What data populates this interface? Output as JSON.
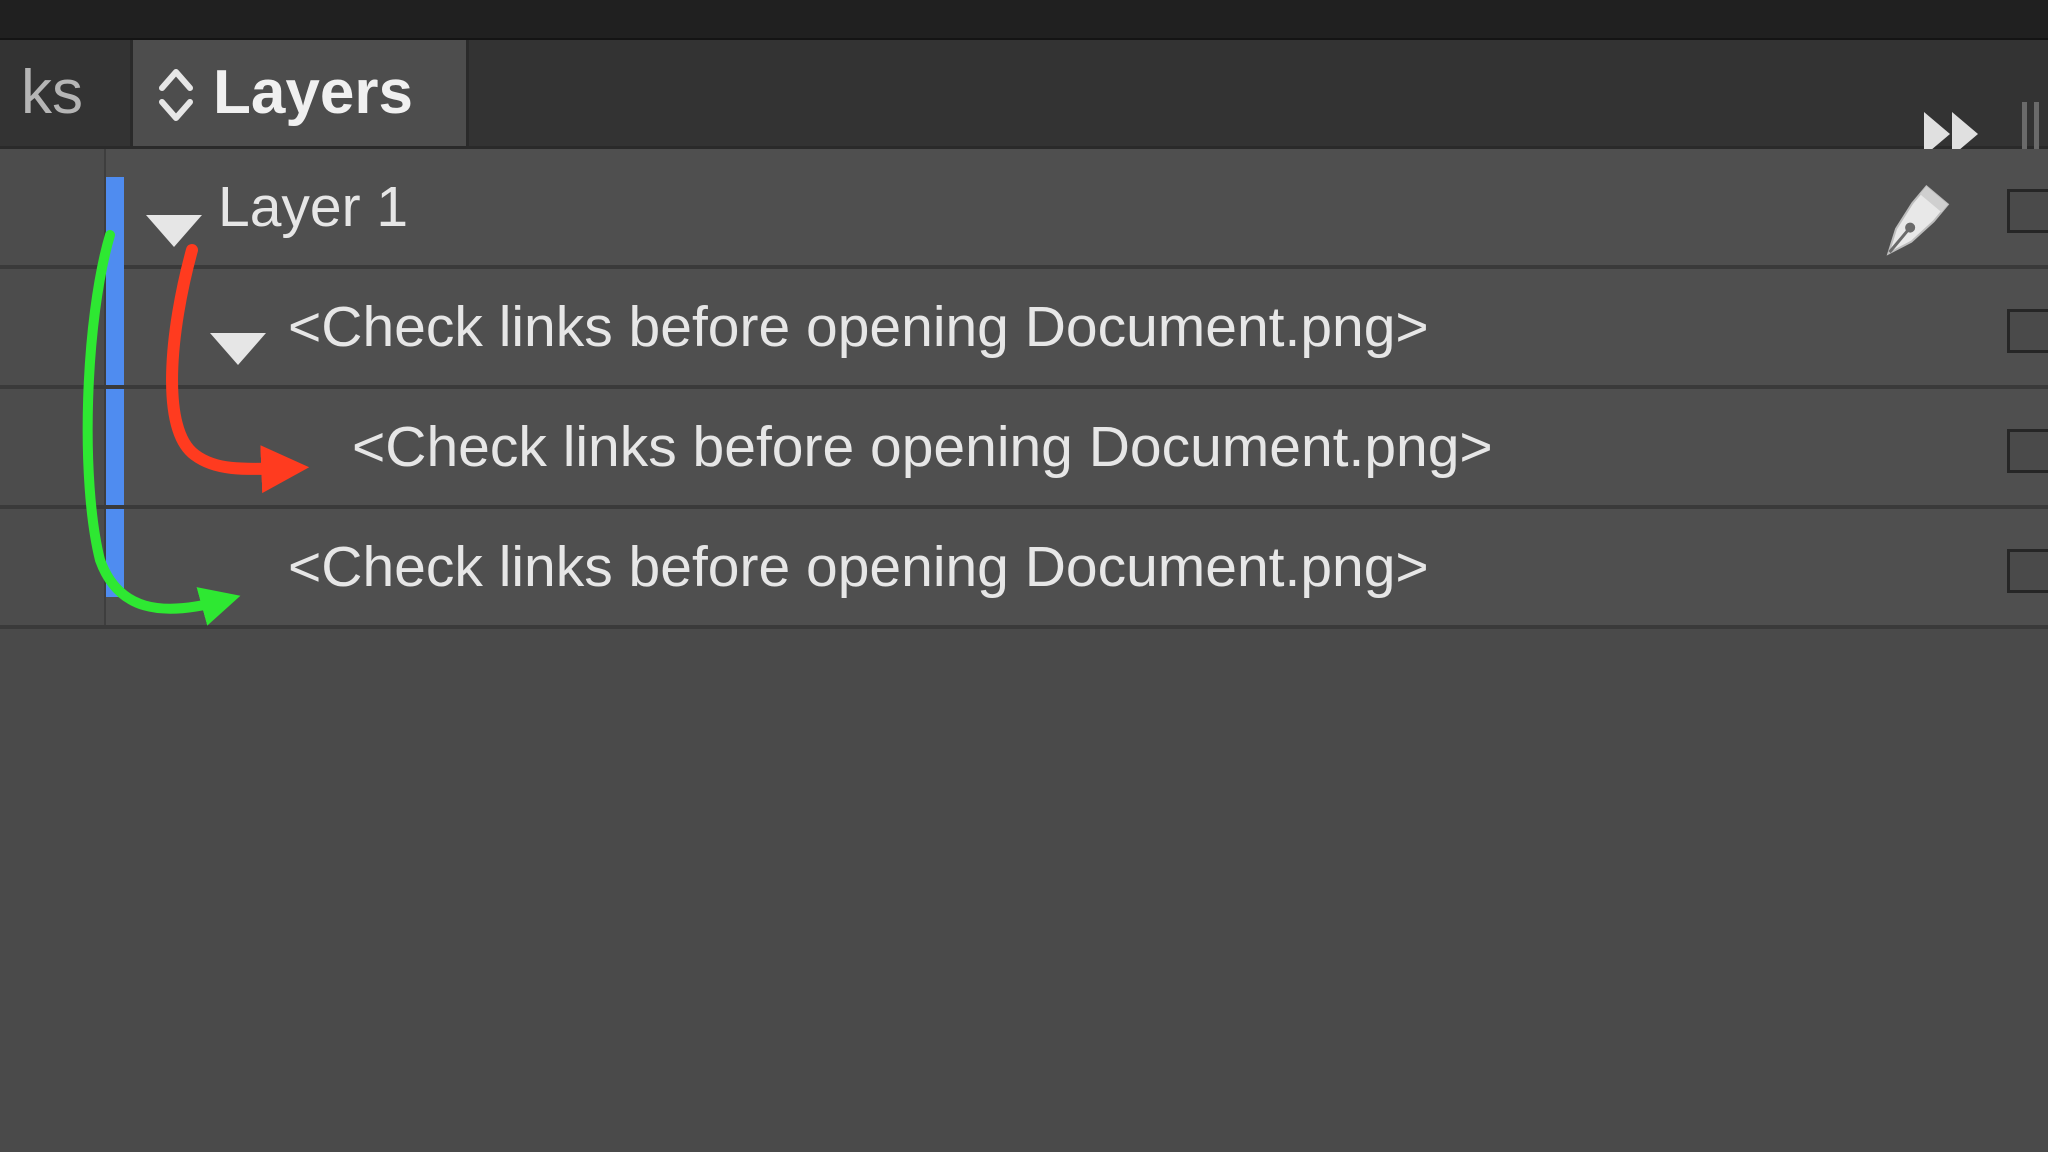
{
  "tabs": {
    "links_partial": "ks",
    "layers": "Layers"
  },
  "layers": [
    {
      "name": "Layer 1",
      "expanded": true
    },
    {
      "name": "<Check links before opening Document.png>",
      "expanded": true
    },
    {
      "name": "<Check links before opening Document.png>",
      "expanded": false
    },
    {
      "name": "<Check links before opening Document.png>",
      "expanded": false
    }
  ],
  "icons": {
    "tab_sort": "up-down-chevron",
    "panel_collapse": "double-chevron-right",
    "panel_grip": "vertical-grip",
    "target_layer": "pen-nib",
    "disclosure": "triangle-down"
  },
  "colors": {
    "layer_color": "#4f8cf0",
    "annotation_red": "#ff3b1f",
    "annotation_green": "#2ee832",
    "panel_bg": "#4a4a4a",
    "tab_bar": "#333333"
  }
}
